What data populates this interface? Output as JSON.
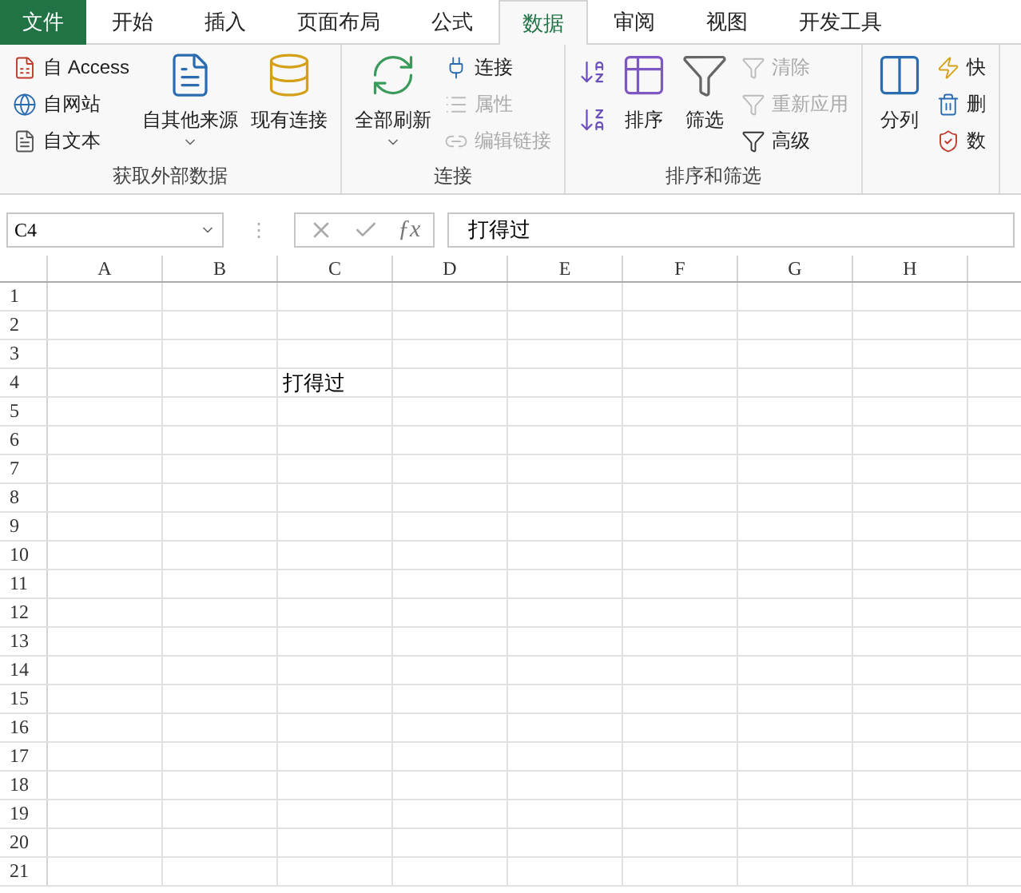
{
  "tabs": [
    {
      "label": "文件",
      "kind": "file",
      "selected": false
    },
    {
      "label": "开始",
      "kind": "tab",
      "selected": false
    },
    {
      "label": "插入",
      "kind": "tab",
      "selected": false
    },
    {
      "label": "页面布局",
      "kind": "tab",
      "selected": false
    },
    {
      "label": "公式",
      "kind": "tab",
      "selected": false
    },
    {
      "label": "数据",
      "kind": "tab",
      "selected": true
    },
    {
      "label": "审阅",
      "kind": "tab",
      "selected": false
    },
    {
      "label": "视图",
      "kind": "tab",
      "selected": false
    },
    {
      "label": "开发工具",
      "kind": "tab",
      "selected": false
    }
  ],
  "ribbon": {
    "groups": [
      {
        "label": "获取外部数据",
        "columns": [
          {
            "kind": "small",
            "items": [
              {
                "label": "自 Access",
                "disabled": false
              },
              {
                "label": "自网站",
                "disabled": false
              },
              {
                "label": "自文本",
                "disabled": false
              }
            ]
          },
          {
            "kind": "large",
            "items": [
              {
                "label": "自其他来源",
                "disabled": false,
                "dropdown": true
              }
            ]
          },
          {
            "kind": "large",
            "items": [
              {
                "label": "现有连接",
                "disabled": false,
                "dropdown": false
              }
            ]
          }
        ]
      },
      {
        "label": "连接",
        "columns": [
          {
            "kind": "large",
            "items": [
              {
                "label": "全部刷新",
                "disabled": false,
                "dropdown": true
              }
            ]
          },
          {
            "kind": "small",
            "items": [
              {
                "label": "连接",
                "disabled": false
              },
              {
                "label": "属性",
                "disabled": true
              },
              {
                "label": "编辑链接",
                "disabled": true
              }
            ]
          }
        ]
      },
      {
        "label": "排序和筛选",
        "columns": [
          {
            "kind": "icons",
            "items": [
              {
                "disabled": false
              },
              {
                "disabled": false
              }
            ]
          },
          {
            "kind": "large",
            "items": [
              {
                "label": "排序",
                "disabled": false,
                "dropdown": false
              }
            ]
          },
          {
            "kind": "large",
            "items": [
              {
                "label": "筛选",
                "disabled": false,
                "dropdown": false
              }
            ]
          },
          {
            "kind": "small",
            "items": [
              {
                "label": "清除",
                "disabled": true
              },
              {
                "label": "重新应用",
                "disabled": true
              },
              {
                "label": "高级",
                "disabled": false
              }
            ]
          }
        ]
      },
      {
        "columns": [
          {
            "kind": "large",
            "items": [
              {
                "label": "分列",
                "disabled": false,
                "dropdown": false
              }
            ]
          },
          {
            "kind": "small",
            "items": [
              {
                "label": "快",
                "disabled": false
              },
              {
                "label": "删",
                "disabled": false
              },
              {
                "label": "数",
                "disabled": false
              }
            ]
          }
        ]
      }
    ]
  },
  "formula_bar": {
    "name_box": "C4",
    "splitter": "⋮",
    "function_label": "ƒx",
    "formula": "打得过"
  },
  "sheet": {
    "columns": [
      "A",
      "B",
      "C",
      "D",
      "E",
      "F",
      "G",
      "H"
    ],
    "rows": [
      {
        "header": "1",
        "cells": []
      },
      {
        "header": "2",
        "cells": []
      },
      {
        "header": "3",
        "cells": []
      },
      {
        "header": "4",
        "cells": [
          "",
          "",
          "打得过"
        ]
      },
      {
        "header": "5",
        "cells": []
      },
      {
        "header": "6",
        "cells": []
      },
      {
        "header": "7",
        "cells": []
      },
      {
        "header": "8",
        "cells": []
      },
      {
        "header": "9",
        "cells": []
      },
      {
        "header": "10",
        "cells": []
      },
      {
        "header": "11",
        "cells": []
      },
      {
        "header": "12",
        "cells": []
      },
      {
        "header": "13",
        "cells": []
      },
      {
        "header": "14",
        "cells": []
      },
      {
        "header": "15",
        "cells": []
      },
      {
        "header": "16",
        "cells": []
      },
      {
        "header": "17",
        "cells": []
      },
      {
        "header": "18",
        "cells": []
      },
      {
        "header": "19",
        "cells": []
      },
      {
        "header": "20",
        "cells": []
      },
      {
        "header": "21",
        "cells": []
      }
    ]
  }
}
